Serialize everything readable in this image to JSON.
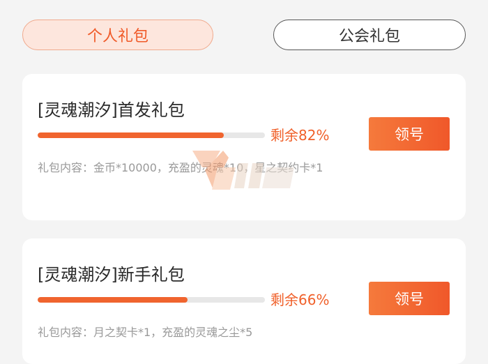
{
  "tabs": [
    {
      "label": "个人礼包",
      "active": true
    },
    {
      "label": "公会礼包",
      "active": false
    }
  ],
  "gifts": [
    {
      "title": "[灵魂潮汐]首发礼包",
      "remaining_label": "剩余82%",
      "remaining_fraction": 0.82,
      "button_label": "领号",
      "content": "礼包内容：金币*10000，充盈的灵魂*10，星之契约卡*1"
    },
    {
      "title": "[灵魂潮汐]新手礼包",
      "remaining_label": "剩余66%",
      "remaining_fraction": 0.66,
      "button_label": "领号",
      "content": "礼包内容：月之契卡*1，充盈的灵魂之尘*5"
    }
  ],
  "colors": {
    "accent": "#f0602a",
    "background": "#f4f4f4",
    "card": "#ffffff"
  }
}
